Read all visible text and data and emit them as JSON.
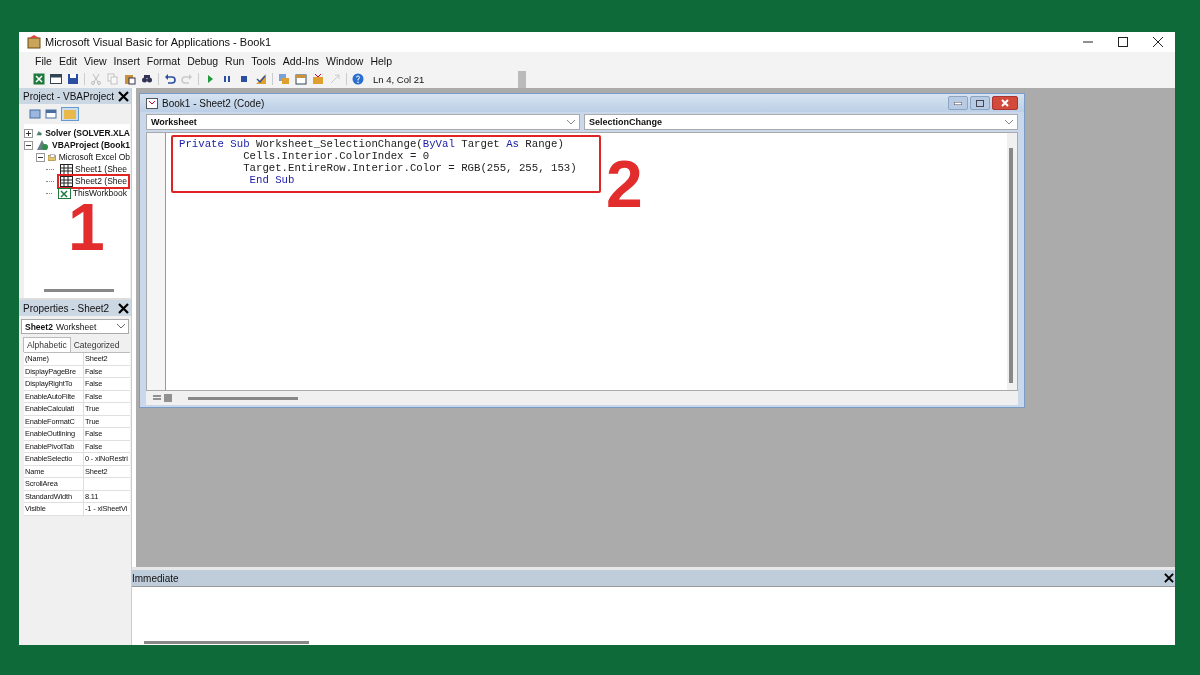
{
  "window": {
    "title": "Microsoft Visual Basic for Applications - Book1"
  },
  "menu": [
    "File",
    "Edit",
    "View",
    "Insert",
    "Format",
    "Debug",
    "Run",
    "Tools",
    "Add-Ins",
    "Window",
    "Help"
  ],
  "toolbar": [
    {
      "kind": "excel",
      "disabled": false
    },
    {
      "kind": "form",
      "disabled": false
    },
    {
      "kind": "save",
      "disabled": false
    },
    {
      "kind": "sep"
    },
    {
      "kind": "cut",
      "disabled": true
    },
    {
      "kind": "copy",
      "disabled": true
    },
    {
      "kind": "paste",
      "disabled": false
    },
    {
      "kind": "find",
      "disabled": false
    },
    {
      "kind": "sep"
    },
    {
      "kind": "undo",
      "disabled": false
    },
    {
      "kind": "redo",
      "disabled": true
    },
    {
      "kind": "sep"
    },
    {
      "kind": "run",
      "disabled": false
    },
    {
      "kind": "pause",
      "disabled": false
    },
    {
      "kind": "stop",
      "disabled": false
    },
    {
      "kind": "design",
      "disabled": false
    },
    {
      "kind": "sep"
    },
    {
      "kind": "project",
      "disabled": false
    },
    {
      "kind": "properties",
      "disabled": false
    },
    {
      "kind": "toolbox",
      "disabled": false
    },
    {
      "kind": "browser",
      "disabled": true
    },
    {
      "kind": "sep"
    },
    {
      "kind": "help",
      "disabled": false
    }
  ],
  "position": "Ln 4, Col 21",
  "project": {
    "title": "Project - VBAProject",
    "tree": [
      {
        "label": "Solver (SOLVER.XLA",
        "kind": "project",
        "expanded": false,
        "marked": false
      },
      {
        "label": "VBAProject (Book1",
        "kind": "project",
        "expanded": true,
        "marked": false,
        "children": [
          {
            "label": "Microsoft Excel Ob",
            "kind": "folder",
            "expanded": true,
            "children": [
              {
                "label": "Sheet1 (Shee",
                "kind": "sheet",
                "marked": false
              },
              {
                "label": "Sheet2 (Shee",
                "kind": "sheet",
                "marked": true
              },
              {
                "label": "ThisWorkbook",
                "kind": "workbook",
                "marked": false
              }
            ]
          }
        ]
      }
    ]
  },
  "properties": {
    "title": "Properties - Sheet2",
    "object_name": "Sheet2",
    "object_type": "Worksheet",
    "tabs": [
      {
        "label": "Alphabetic",
        "selected": true
      },
      {
        "label": "Categorized",
        "selected": false
      }
    ],
    "rows": [
      {
        "name": "(Name)",
        "value": "Sheet2"
      },
      {
        "name": "DisplayPageBre",
        "value": "False"
      },
      {
        "name": "DisplayRightTo",
        "value": "False"
      },
      {
        "name": "EnableAutoFilte",
        "value": "False"
      },
      {
        "name": "EnableCalculati",
        "value": "True"
      },
      {
        "name": "EnableFormatC",
        "value": "True"
      },
      {
        "name": "EnableOutlining",
        "value": "False"
      },
      {
        "name": "EnablePivotTab",
        "value": "False"
      },
      {
        "name": "EnableSelectio",
        "value": "0 - xlNoRestri"
      },
      {
        "name": "Name",
        "value": "Sheet2"
      },
      {
        "name": "ScrollArea"
      },
      {
        "name": "StandardWidth",
        "value": "8.11"
      },
      {
        "name": "Visible",
        "value": "-1 - xlSheetVi"
      }
    ]
  },
  "code_window": {
    "title": "Book1 - Sheet2 (Code)",
    "object": "Worksheet",
    "procedure": "SelectionChange",
    "marked": true,
    "lines": [
      [
        {
          "text": "Private Sub ",
          "kind": "keyword"
        },
        {
          "text": "Worksheet_SelectionChange(",
          "kind": "plain"
        },
        {
          "text": "ByVal",
          "kind": "keyword"
        },
        {
          "text": " Target ",
          "kind": "plain"
        },
        {
          "text": "As",
          "kind": "keyword"
        },
        {
          "text": " Range)",
          "kind": "plain"
        }
      ],
      [
        {
          "text": "          Cells.Interior.ColorIndex = 0",
          "kind": "plain"
        }
      ],
      [
        {
          "text": "          Target.EntireRow.Interior.Color = RGB(255, 255, 153)",
          "kind": "plain"
        }
      ],
      [
        {
          "text": "           End Sub",
          "kind": "keyword"
        }
      ]
    ]
  },
  "immediate": {
    "title": "Immediate"
  },
  "annotations": [
    {
      "label": "1"
    },
    {
      "label": "2"
    }
  ]
}
